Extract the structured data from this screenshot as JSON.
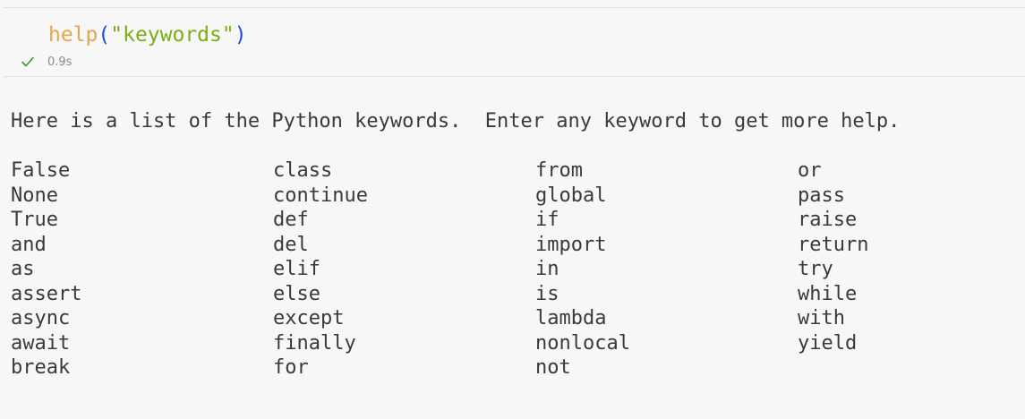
{
  "cell": {
    "code": {
      "function": "help",
      "open_paren": "(",
      "argument": "\"keywords\"",
      "close_paren": ")"
    },
    "status": {
      "icon": "check-icon",
      "time": "0.9s",
      "color": "#3f8f3f"
    }
  },
  "output": {
    "intro": "Here is a list of the Python keywords.  Enter any keyword to get more help.",
    "columns": [
      [
        "False",
        "None",
        "True",
        "and",
        "as",
        "assert",
        "async",
        "await",
        "break"
      ],
      [
        "class",
        "continue",
        "def",
        "del",
        "elif",
        "else",
        "except",
        "finally",
        "for"
      ],
      [
        "from",
        "global",
        "if",
        "import",
        "in",
        "is",
        "lambda",
        "nonlocal",
        "not"
      ],
      [
        "or",
        "pass",
        "raise",
        "return",
        "try",
        "while",
        "with",
        "yield"
      ]
    ]
  },
  "colors": {
    "function": "#e5a64b",
    "paren": "#1f4fd6",
    "string": "#7cad16",
    "text": "#3a3a3a",
    "background": "#f7f7f8"
  }
}
